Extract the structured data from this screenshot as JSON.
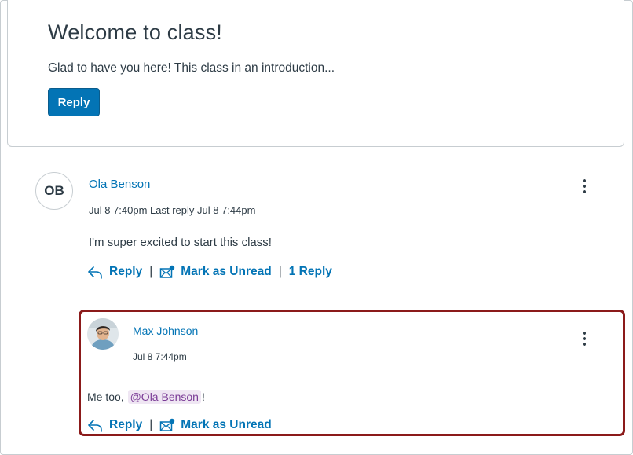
{
  "topic": {
    "title": "Welcome to class!",
    "body": "Glad to have you here! This class in an introduction...",
    "reply_button": "Reply"
  },
  "entry": {
    "avatar_initials": "OB",
    "author": "Ola Benson",
    "meta": "Jul 8 7:40pm  Last reply Jul 8 7:44pm",
    "message": "I'm super excited to start this class!",
    "actions": {
      "reply": "Reply",
      "mark_unread": "Mark as Unread",
      "reply_count": "1 Reply"
    },
    "separator": "|"
  },
  "reply": {
    "author": "Max Johnson",
    "meta": "Jul 8 7:44pm",
    "message_prefix": "Me too, ",
    "mention": "@Ola Benson",
    "message_suffix": "!",
    "actions": {
      "reply": "Reply",
      "mark_unread": "Mark as Unread"
    },
    "separator": "|"
  },
  "colors": {
    "link": "#0374b5",
    "primary_button": "#0374b5",
    "highlight_border": "#8b1a1a",
    "mention_bg": "#efe6f3",
    "mention_text": "#7a3b96"
  },
  "icons": {
    "reply": "reply-arrow-icon",
    "mark_unread": "envelope-unread-icon",
    "options": "kebab-menu-icon"
  }
}
